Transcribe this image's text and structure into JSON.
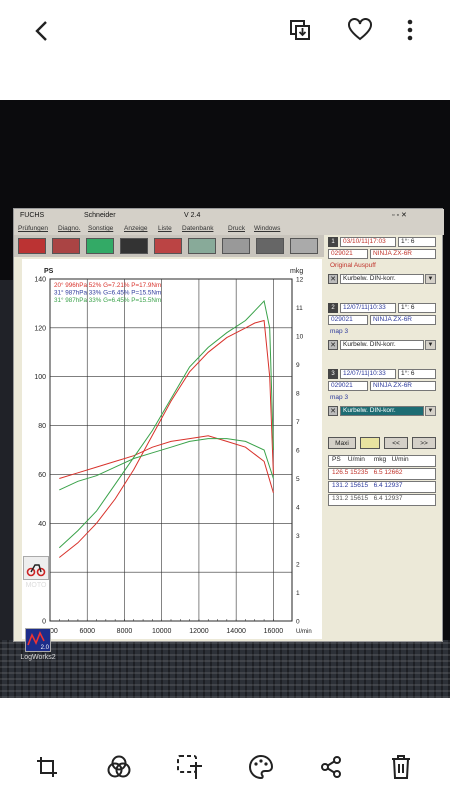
{
  "toolbar": {
    "back_icon": "chevron-left-icon",
    "icons": [
      "save-to-device-icon",
      "heart-icon",
      "more-vertical-icon"
    ]
  },
  "window": {
    "title_left": "FUCHS",
    "title_mid": "Schneider",
    "title_version": "V 2.4",
    "menu": [
      "Prüfungen",
      "Diagno.",
      "Sonstige",
      "Anzeige",
      "Liste",
      "Datenbank",
      "Druck",
      "Windows"
    ]
  },
  "chart_data": {
    "type": "line",
    "title": "",
    "ylabel": "PS",
    "y2label": "mkg",
    "xlabel": "U/min",
    "xlim": [
      4000,
      17000
    ],
    "ylim": [
      0,
      140
    ],
    "y2lim": [
      0,
      12
    ],
    "x_ticks": [
      4000,
      6000,
      8000,
      10000,
      12000,
      14000,
      16000
    ],
    "y_ticks": [
      0,
      20,
      40,
      60,
      80,
      100,
      120,
      140
    ],
    "y2_ticks": [
      0,
      1,
      2,
      3,
      4,
      5,
      6,
      7,
      8,
      9,
      10,
      11,
      12
    ],
    "grid": true,
    "legend": [
      {
        "text": "20° 996hPa 52% G=7.21% P=17.9Nm",
        "color": "#d8322b"
      },
      {
        "text": "31° 987hPa 33% G=6.45% P=15.5Nm",
        "color": "#2d3a9c"
      },
      {
        "text": "31° 987hPa 33% G=6.45% P=15.5Nm",
        "color": "#3aa24a"
      }
    ],
    "series": [
      {
        "color": "#d8322b",
        "axis": "left",
        "x": [
          4500,
          5500,
          6500,
          7500,
          8500,
          9500,
          10500,
          11500,
          12500,
          13500,
          14500,
          15000,
          15500,
          15800,
          16000
        ],
        "values": [
          26,
          32,
          40,
          50,
          62,
          76,
          90,
          102,
          110,
          116,
          120,
          122,
          123,
          100,
          60
        ]
      },
      {
        "color": "#d8322b",
        "axis": "right",
        "x": [
          4500,
          5500,
          6500,
          7500,
          8500,
          9500,
          10500,
          11500,
          12500,
          13500,
          14500,
          15500,
          16000
        ],
        "values": [
          5.0,
          5.2,
          5.4,
          5.6,
          5.8,
          6.1,
          6.3,
          6.4,
          6.5,
          6.3,
          6.1,
          5.6,
          4.5
        ]
      },
      {
        "color": "#3aa24a",
        "axis": "left",
        "x": [
          4500,
          5500,
          6500,
          7500,
          8500,
          9500,
          10500,
          11500,
          12500,
          13500,
          14500,
          15000,
          15500,
          15800,
          16000
        ],
        "values": [
          30,
          37,
          45,
          56,
          67,
          78,
          91,
          104,
          112,
          118,
          123,
          127,
          131,
          120,
          70
        ]
      },
      {
        "color": "#3aa24a",
        "axis": "right",
        "x": [
          4500,
          5500,
          6500,
          7500,
          8500,
          9500,
          10500,
          11500,
          12500,
          13500,
          14500,
          15500,
          16000
        ],
        "values": [
          4.6,
          4.9,
          5.1,
          5.4,
          5.7,
          5.9,
          6.1,
          6.3,
          6.4,
          6.4,
          6.3,
          6.0,
          5.0
        ]
      }
    ]
  },
  "side_panel": {
    "runs": [
      {
        "num": "1",
        "date": "03/10/11|17:03",
        "gear": "1°: 6",
        "id": "029021",
        "bike": "NINJA ZX-6R",
        "note": "Original Auspuff",
        "corr": "Kurbelw. DIN-korr."
      },
      {
        "num": "2",
        "date": "12/07/11|10:33",
        "gear": "1°: 6",
        "id": "029021",
        "bike": "NINJA ZX-6R",
        "note": "map 3",
        "corr": "Kurbelw. DIN-korr."
      },
      {
        "num": "3",
        "date": "12/07/11|10:33",
        "gear": "1°: 6",
        "id": "029021",
        "bike": "NINJA ZX-6R",
        "note": "map 3",
        "corr": "Kurbelw. DIN-korr."
      }
    ],
    "buttons": [
      "Maxi",
      "<<",
      ">>"
    ],
    "table_header": "PS    U/min     mkg   U/min",
    "table_rows": [
      "126.5 15235   6.5 12662",
      "131.2 15615   6.4 12937",
      "131.2 15615   6.4 12937"
    ]
  },
  "desktop": {
    "icons": [
      {
        "label": "MOTO",
        "icon": "moto-app-icon"
      },
      {
        "label": "LogWorks2",
        "icon": "logworks-app-icon"
      }
    ],
    "logworks_badge": "2.0"
  },
  "bottombar": {
    "icons": [
      "crop-icon",
      "filter-icon",
      "text-icon",
      "palette-icon",
      "share-icon",
      "trash-icon"
    ]
  }
}
